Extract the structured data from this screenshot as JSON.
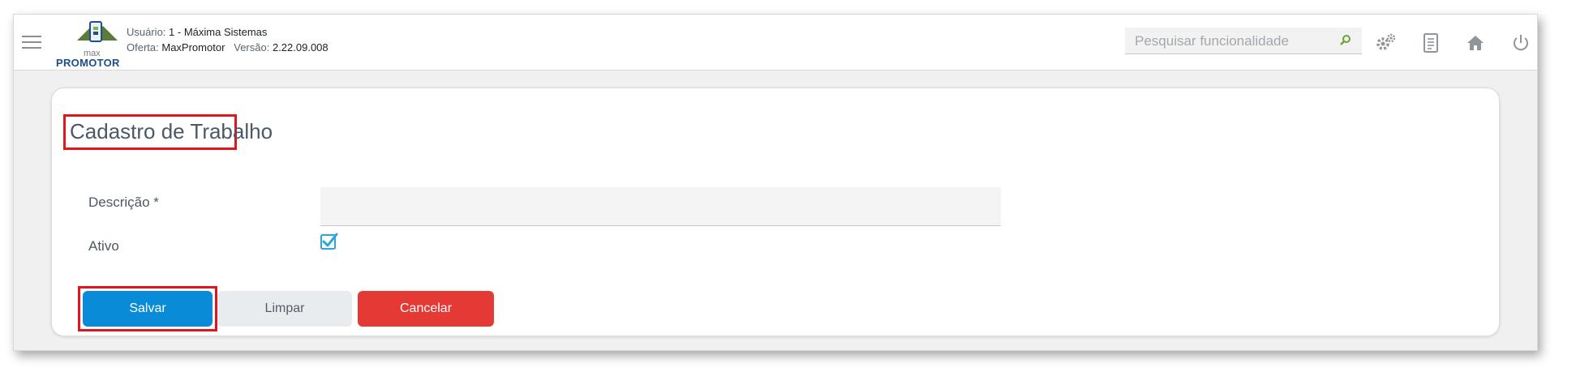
{
  "header": {
    "logo_text_small": "max",
    "logo_text": "PROMOTOR",
    "user_label": "Usuário:",
    "user_value": "1 - Máxima Sistemas",
    "offer_label": "Oferta:",
    "offer_value": "MaxPromotor",
    "version_label": "Versão:",
    "version_value": "2.22.09.008",
    "search_placeholder": "Pesquisar funcionalidade",
    "icons": [
      "menu-icon",
      "search-icon",
      "gears-icon",
      "document-icon",
      "home-icon",
      "power-icon"
    ]
  },
  "form": {
    "title": "Cadastro de Trabalho",
    "description_label": "Descrição *",
    "description_value": "",
    "active_label": "Ativo",
    "active_checked": true
  },
  "buttons": {
    "save": "Salvar",
    "clear": "Limpar",
    "cancel": "Cancelar"
  },
  "colors": {
    "primary": "#0a8bd8",
    "danger": "#e53935",
    "highlight": "#e3151c",
    "checkbox": "#2aa7d8"
  }
}
